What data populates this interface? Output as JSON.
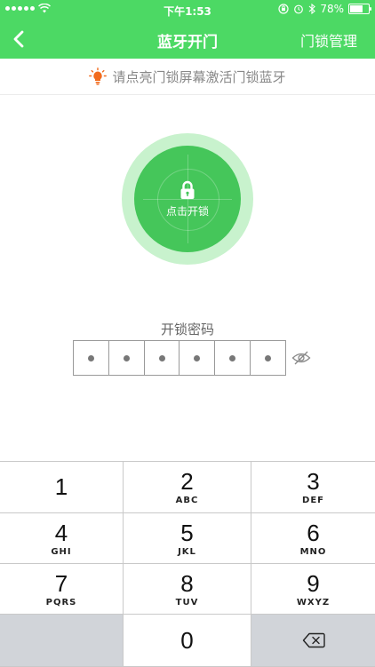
{
  "status": {
    "time": "下午1:53",
    "battery": "78%",
    "battery_level": 0.78
  },
  "nav": {
    "title": "蓝牙开门",
    "right_action": "门锁管理"
  },
  "hint": {
    "text": "请点亮门锁屏幕激活门锁蓝牙",
    "icon": "bulb-icon"
  },
  "unlock": {
    "label": "点击开锁",
    "icon": "lock-icon"
  },
  "password": {
    "label": "开锁密码",
    "digits": [
      "•",
      "•",
      "•",
      "•",
      "•",
      "•"
    ],
    "eye_icon": "eye-off-icon"
  },
  "keypad": {
    "keys": [
      {
        "num": "1",
        "letters": ""
      },
      {
        "num": "2",
        "letters": "ABC"
      },
      {
        "num": "3",
        "letters": "DEF"
      },
      {
        "num": "4",
        "letters": "GHI"
      },
      {
        "num": "5",
        "letters": "JKL"
      },
      {
        "num": "6",
        "letters": "MNO"
      },
      {
        "num": "7",
        "letters": "PQRS"
      },
      {
        "num": "8",
        "letters": "TUV"
      },
      {
        "num": "9",
        "letters": "WXYZ"
      },
      {
        "num": "0",
        "letters": ""
      }
    ],
    "delete_icon": "backspace-icon"
  },
  "colors": {
    "brand_green": "#4cd964",
    "button_green": "#45c65a",
    "hint_icon_orange": "#f26b1d"
  }
}
